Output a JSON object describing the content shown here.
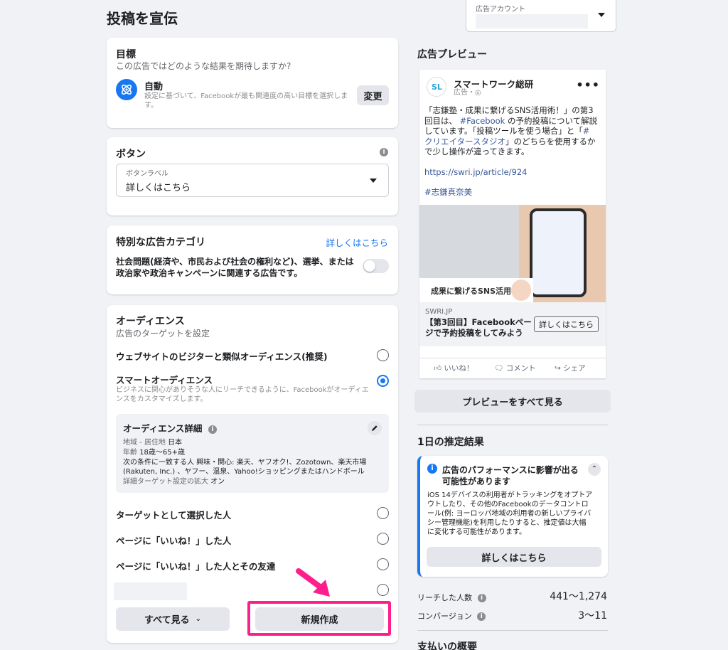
{
  "page_title": "投稿を宣伝",
  "ad_account": {
    "label": "広告アカウント",
    "value": ""
  },
  "objective": {
    "title": "目標",
    "question": "この広告ではどのような結果を期待しますか?",
    "auto_label": "自動",
    "auto_desc": "設定に基づいて、Facebookが最も関連度の高い目標を選択します。",
    "change_button": "変更"
  },
  "button_section": {
    "title": "ボタン",
    "field_label": "ボタンラベル",
    "field_value": "詳しくはこちら"
  },
  "special_category": {
    "title": "特別な広告カテゴリ",
    "link": "詳しくはこちら",
    "desc": "社会問題(経済や、市民および社会の権利など)、選挙、または政治家や政治キャンペーンに関連する広告です。",
    "toggle_on": false
  },
  "audience": {
    "title": "オーディエンス",
    "subtitle": "広告のターゲットを設定",
    "option_lookalike": "ウェブサイトのビジターと類似オーディエンス(推奨)",
    "option_smart": "スマートオーディエンス",
    "option_smart_desc": "ビジネスに関心がありそうな人にリーチできるように、Facebookがオーディエンスをカスタマイズします。",
    "detail_title": "オーディエンス詳細",
    "detail_location_label": "地域 - 居住地",
    "detail_location_value": "日本",
    "detail_age_label": "年齢",
    "detail_age_value": "18歳〜65+歳",
    "detail_interests_line1": "次の条件に一致する人 興味・関心: 楽天、ヤフオク!、Zozotown、楽天市場",
    "detail_interests_line2": "(Rakuten, Inc.) 、ヤフー、温泉、Yahoo!ショッピングまたはハンドボール",
    "detail_expansion_label": "詳細ターゲット設定の拡大",
    "detail_expansion_value": "オン",
    "option_targeted": "ターゲットとして選択した人",
    "option_page_likes": "ページに「いいね！」した人",
    "option_page_likes_friends": "ページに「いいね！」した人とその友達",
    "see_all_button": "すべて見る",
    "create_new_button": "新規作成"
  },
  "preview": {
    "title": "広告プレビュー",
    "page_name": "スマートワーク総研",
    "sponsored": "広告・",
    "body_line1": "「志鎌塾・成果に繋げるSNS活用術！」の第3",
    "body_line2a": "回目は、",
    "body_hashtag1": "#Facebook",
    "body_line2b": " の予約投稿について解説",
    "body_line3": "しています。「投稿ツールを使う場合」と「",
    "body_hashtag2a": "#",
    "body_hashtag2b": "クリエイタースタジオ",
    "body_line4b": "」のどちらを使用するか",
    "body_line5": "で少し操作が違ってきます。",
    "link_url": "https://swri.jp/article/924",
    "hashtag3": "#志鎌真奈美",
    "image_caption": "成果に繋げるSNS活用術",
    "domain": "SWRI.JP",
    "headline_line1": "【第3回目】Facebookペー",
    "headline_line2": "ジで予約投稿をしてみよう",
    "cta_button": "詳しくはこちら",
    "like_label": "いいね！",
    "comment_label": "コメント",
    "share_label": "シェア",
    "see_all_button": "プレビューをすべて見る"
  },
  "estimates": {
    "title": "1日の推定結果",
    "alert_title_line1": "広告のパフォーマンスに影響が出る",
    "alert_title_line2": "可能性があります",
    "alert_body_line1": "iOS 14デバイスの利用者がトラッキングをオプトア",
    "alert_body_line2": "ウトしたり、その他のFacebookのデータコントロ",
    "alert_body_line3": "ール(例: ヨーロッパ地域の利用者の新しいプライバ",
    "alert_body_line4": "シー管理機能)を利用したりすると、推定値は大幅",
    "alert_body_line5": "に変化する可能性があります。",
    "alert_button": "詳しくはこちら",
    "reach_label": "リーチした人数",
    "reach_value": "441〜1,274",
    "conversion_label": "コンバージョン",
    "conversion_value": "3〜11"
  },
  "payment": {
    "title": "支払いの概要"
  },
  "colors": {
    "accent": "#1877f2",
    "highlight": "#ff1e8c"
  }
}
